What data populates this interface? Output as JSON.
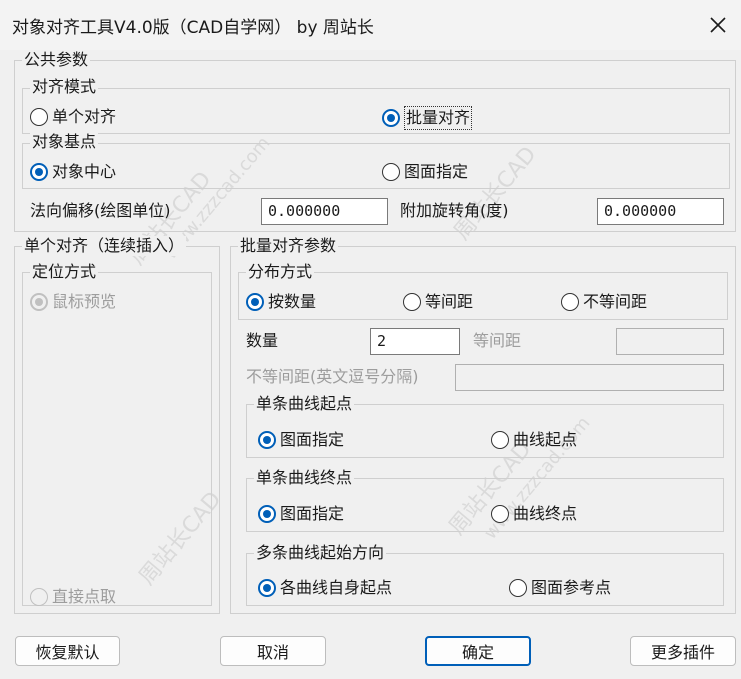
{
  "window": {
    "title": "对象对齐工具V4.0版（CAD自学网） by 周站长"
  },
  "common": {
    "legend": "公共参数",
    "align_mode": {
      "legend": "对齐模式",
      "options": [
        {
          "label": "单个对齐",
          "checked": false
        },
        {
          "label": "批量对齐",
          "checked": true
        }
      ]
    },
    "base_point": {
      "legend": "对象基点",
      "options": [
        {
          "label": "对象中心",
          "checked": true
        },
        {
          "label": "图面指定",
          "checked": false
        }
      ]
    },
    "offset_label": "法向偏移(绘图单位)",
    "offset_value": "0.000000",
    "rotation_label": "附加旋转角(度)",
    "rotation_value": "0.000000"
  },
  "single": {
    "legend": "单个对齐（连续插入）",
    "positioning": {
      "legend": "定位方式",
      "preview_label": "鼠标预览",
      "direct_label": "直接点取"
    }
  },
  "batch": {
    "legend": "批量对齐参数",
    "distribution": {
      "legend": "分布方式",
      "options": [
        {
          "label": "按数量",
          "checked": true
        },
        {
          "label": "等间距",
          "checked": false
        },
        {
          "label": "不等间距",
          "checked": false
        }
      ]
    },
    "count_label": "数量",
    "count_value": "2",
    "spacing_label": "等间距",
    "spacing_value": "",
    "unequal_label": "不等间距(英文逗号分隔)",
    "unequal_value": "",
    "single_start": {
      "legend": "单条曲线起点",
      "options": [
        {
          "label": "图面指定",
          "checked": true
        },
        {
          "label": "曲线起点",
          "checked": false
        }
      ]
    },
    "single_end": {
      "legend": "单条曲线终点",
      "options": [
        {
          "label": "图面指定",
          "checked": true
        },
        {
          "label": "曲线终点",
          "checked": false
        }
      ]
    },
    "multi_direction": {
      "legend": "多条曲线起始方向",
      "options": [
        {
          "label": "各曲线自身起点",
          "checked": true
        },
        {
          "label": "图面参考点",
          "checked": false
        }
      ]
    }
  },
  "buttons": {
    "restore": "恢复默认",
    "cancel": "取消",
    "ok": "确定",
    "more": "更多插件"
  },
  "watermark": {
    "lines": [
      "周站长CAD",
      "www.zzzcad.com"
    ]
  },
  "colors": {
    "accent": "#005fb8",
    "background": "#f0f0f0"
  }
}
